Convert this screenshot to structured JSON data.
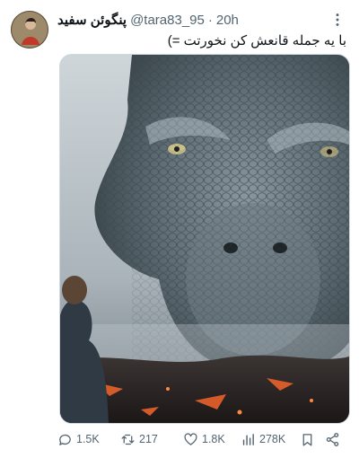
{
  "tweet": {
    "display_name": "پنگوئن سفید",
    "handle": "@tara83_95",
    "separator": "·",
    "time": "20h",
    "text": "با یه جمله قانعش کن نخورتت =)",
    "more_icon": "more-horizontal-icon"
  },
  "actions": {
    "replies": "1.5K",
    "retweets": "217",
    "likes": "1.8K",
    "views": "278K"
  },
  "icons": {
    "reply": "reply-icon",
    "retweet": "retweet-icon",
    "like": "heart-icon",
    "views": "views-chart-icon",
    "bookmark": "bookmark-icon",
    "share": "share-icon"
  },
  "colors": {
    "text": "#0f1419",
    "muted": "#536471",
    "border": "#cfd9de"
  }
}
